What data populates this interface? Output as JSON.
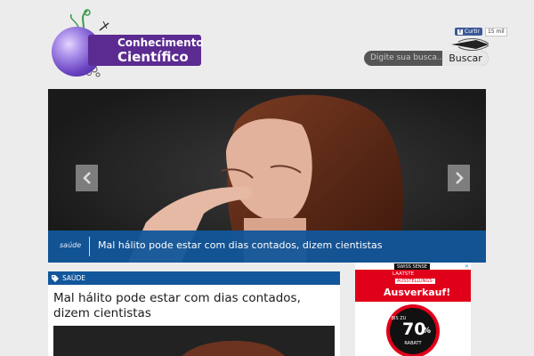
{
  "header": {
    "logo": {
      "line1": "Conhecimento",
      "line2": "Científico"
    },
    "facebook": {
      "like_label": "Curtir",
      "count": "15 mil"
    },
    "search": {
      "placeholder": "Digite sua busca...",
      "button_label": "Buscar"
    }
  },
  "slider": {
    "category": "saúde",
    "title": "Mal hálito pode estar com dias contados, dizem cientistas"
  },
  "article": {
    "category": "SAÚDE",
    "title": "Mal hálito pode estar com dias contados, dizem cientistas"
  },
  "ad": {
    "brand": "SWISS SENSE",
    "line1": "LAATSTE",
    "line2": "AUSSTELLUNGS-",
    "headline": "Ausverkauf!",
    "badge_prefix": "BIS ZU",
    "badge_value": "70",
    "badge_unit": "%",
    "badge_label": "RABATT"
  },
  "colors": {
    "brand_blue": "#12569b",
    "logo_purple": "#5b2b91",
    "ad_red": "#e1001a"
  },
  "icons": {
    "prev": "chevron-left-icon",
    "next": "chevron-right-icon",
    "tag": "tag-icon",
    "rocket": "rocket-icon"
  }
}
